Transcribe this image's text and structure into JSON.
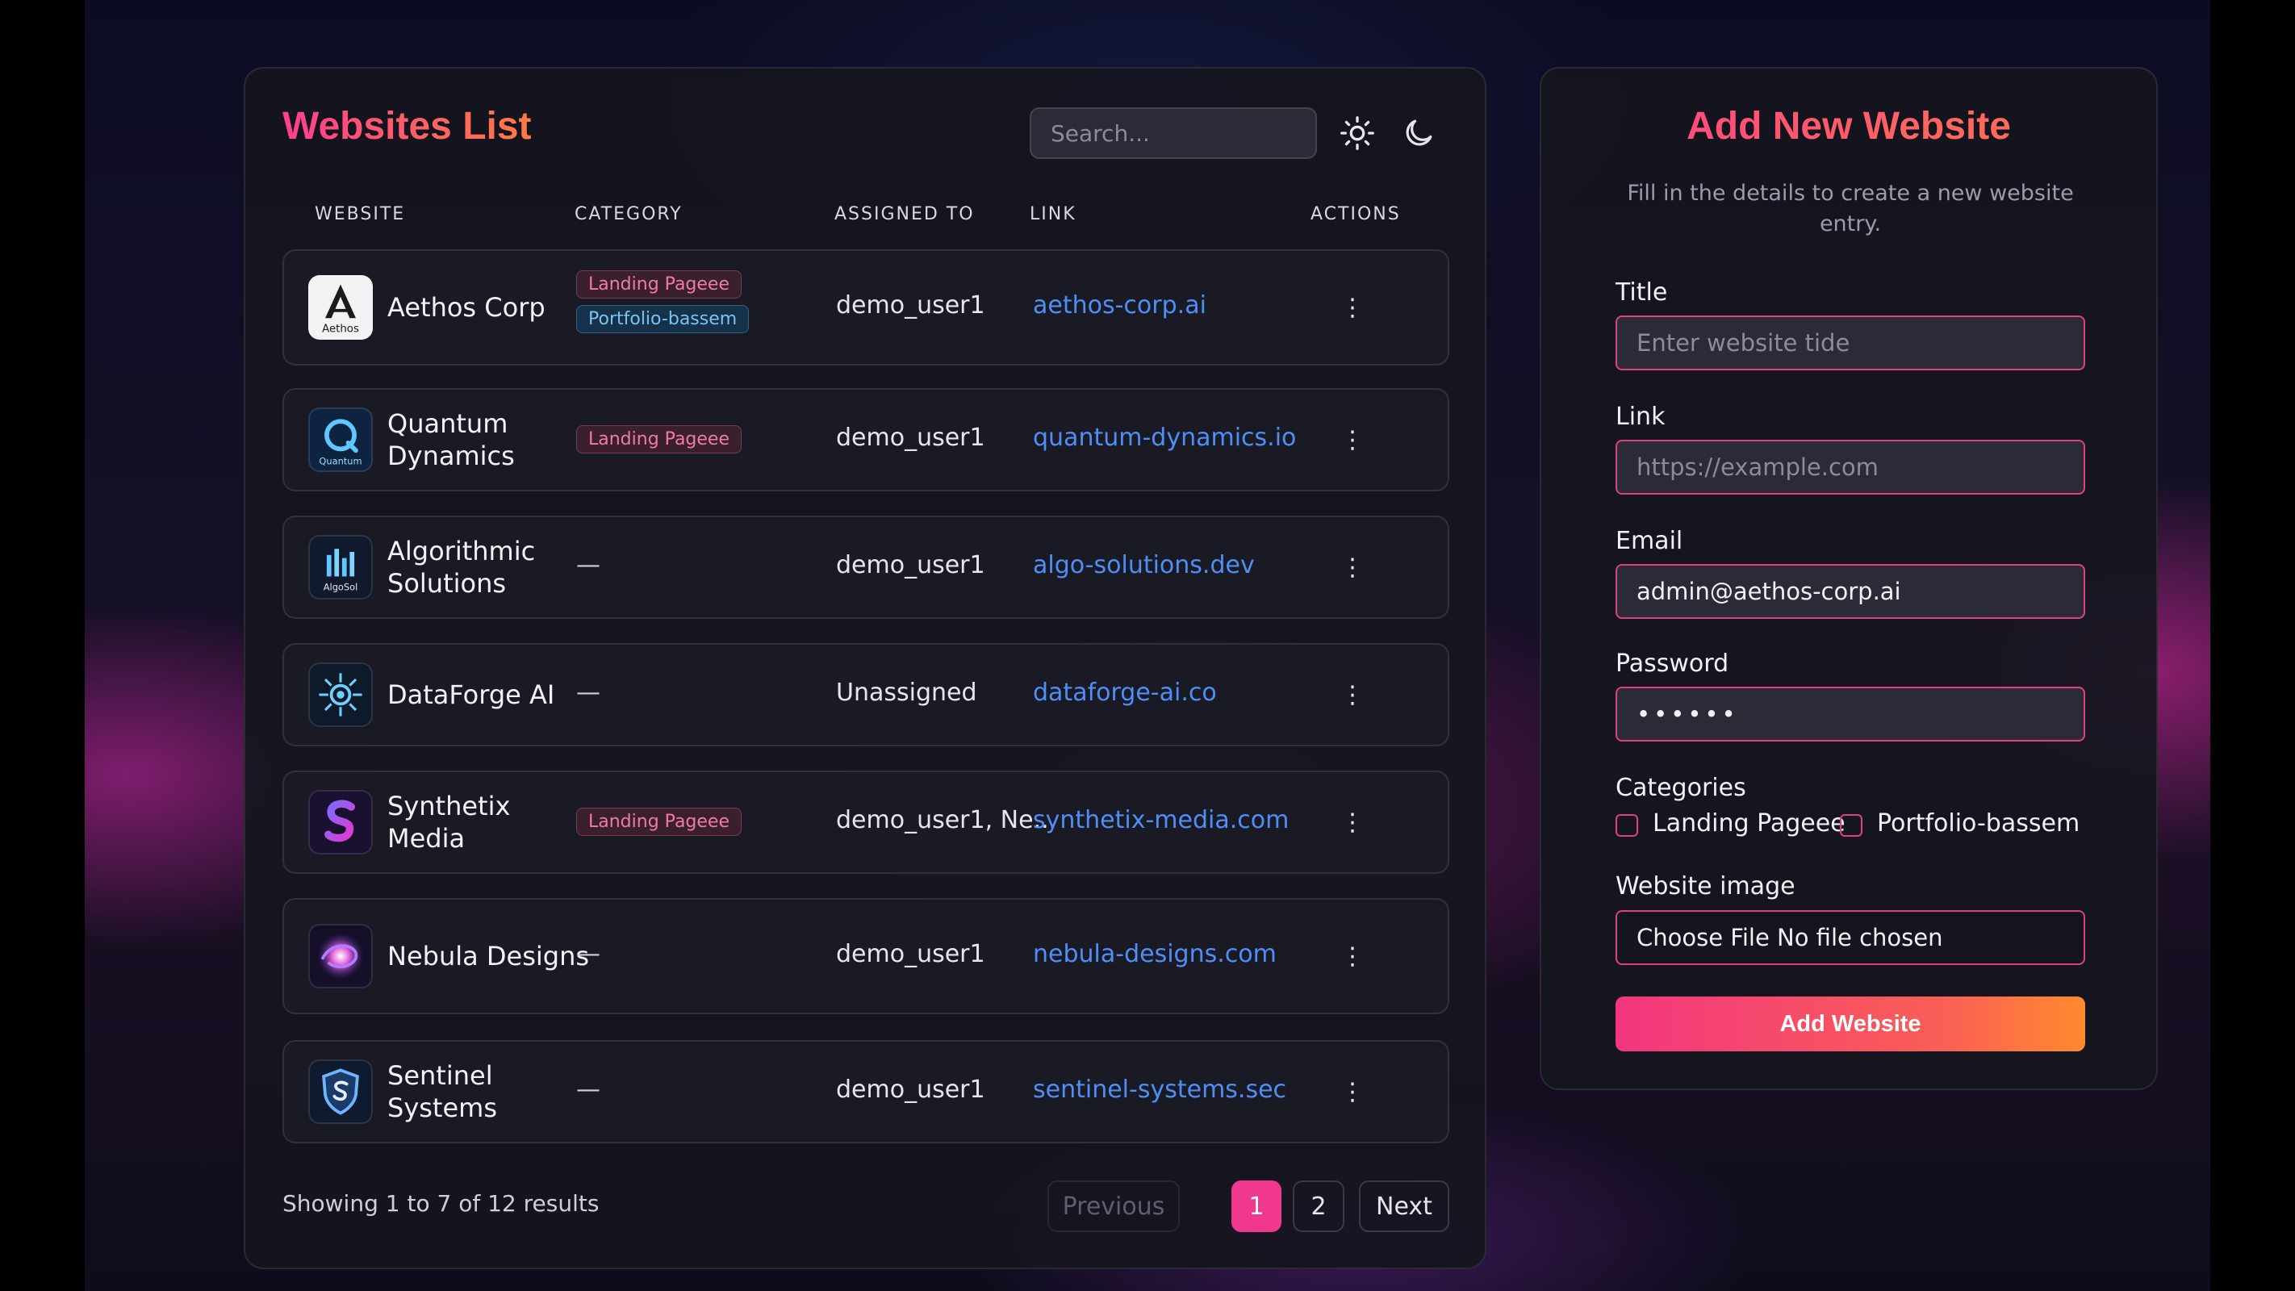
{
  "list": {
    "title": "Websites List",
    "search_placeholder": "Search...",
    "theme_icons": [
      "sun-icon",
      "moon-icon"
    ],
    "columns": [
      "WEBSITE",
      "CATEGORY",
      "ASSIGNED TO",
      "LINK",
      "ACTIONS"
    ],
    "rows": [
      {
        "name": "Aethos Corp",
        "logo": "aethos-logo",
        "logo_text": "Aethos",
        "categories": [
          "Landing Pageee",
          "Portfolio-bassem"
        ],
        "assigned": "demo_user1",
        "link": "aethos-corp.ai"
      },
      {
        "name": "Quantum Dynamics",
        "logo": "quantum-logo",
        "logo_text": "Quantum",
        "categories": [
          "Landing Pageee"
        ],
        "assigned": "demo_user1",
        "link": "quantum-dynamics.io"
      },
      {
        "name": "Algorithmic Solutions",
        "logo": "algosol-logo",
        "logo_text": "AlgoSol",
        "categories": [],
        "assigned": "demo_user1",
        "link": "algo-solutions.dev"
      },
      {
        "name": "DataForge AI",
        "logo": "dataforge-logo",
        "logo_text": "",
        "categories": [],
        "assigned": "Unassigned",
        "link": "dataforge-ai.co"
      },
      {
        "name": "Synthetix Media",
        "logo": "synthetix-logo",
        "logo_text": "",
        "categories": [
          "Landing Pageee"
        ],
        "assigned": "demo_user1, Ne...",
        "link": "synthetix-media.com"
      },
      {
        "name": "Nebula Designs",
        "logo": "nebula-logo",
        "logo_text": "",
        "categories": [],
        "assigned": "demo_user1",
        "link": "nebula-designs.com"
      },
      {
        "name": "Sentinel Systems",
        "logo": "sentinel-logo",
        "logo_text": "",
        "categories": [],
        "assigned": "demo_user1",
        "link": "sentinel-systems.sec"
      }
    ],
    "empty_category": "—",
    "actions_glyph": "⋮",
    "results_text": "Showing 1 to 7 of 12 results",
    "pagination": {
      "previous": "Previous",
      "pages": [
        "1",
        "2"
      ],
      "current": "1",
      "next": "Next"
    }
  },
  "form": {
    "title": "Add New Website",
    "subtitle": "Fill in the details to create a new website entry.",
    "title_label": "Title",
    "title_placeholder": "Enter website tide",
    "link_label": "Link",
    "link_placeholder": "https://example.com",
    "email_label": "Email",
    "email_value": "admin@aethos-corp.ai",
    "password_label": "Password",
    "password_value": "••••••",
    "categories_label": "Categories",
    "category_options": [
      "Landing Pageee",
      "Portfolio-bassem"
    ],
    "image_label": "Website image",
    "file_text": "Choose File No file chosen",
    "submit_label": "Add Website"
  },
  "colors": {
    "accent_pink": "#f0388f",
    "accent_orange": "#ff8a2e",
    "link_blue": "#4f8ef7",
    "panel_bg": "#14151e"
  }
}
